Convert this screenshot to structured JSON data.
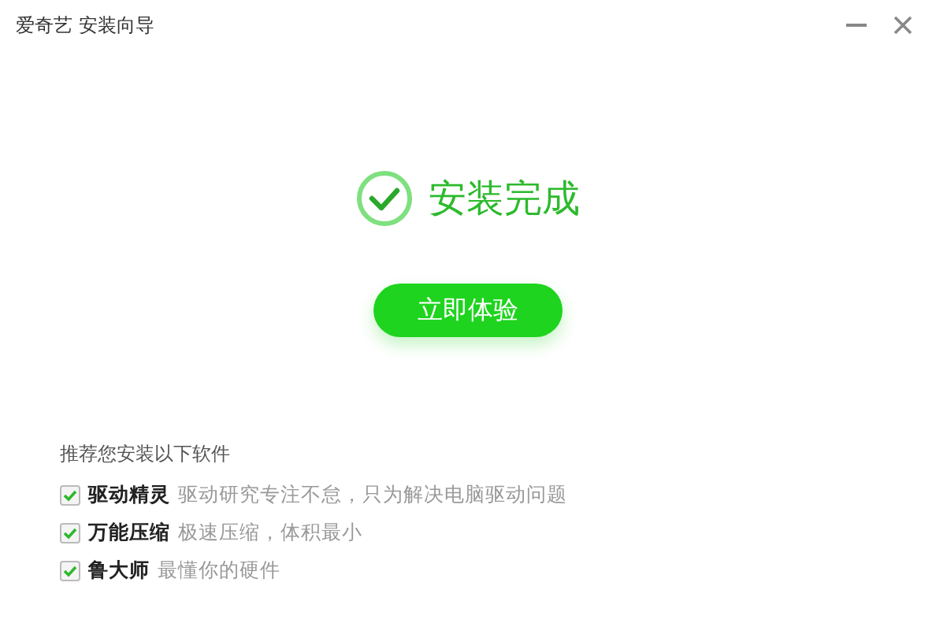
{
  "window": {
    "title": "爱奇艺 安装向导"
  },
  "status": {
    "message": "安装完成"
  },
  "primary_button": {
    "label": "立即体验"
  },
  "recommendations": {
    "heading": "推荐您安装以下软件",
    "items": [
      {
        "name": "驱动精灵",
        "description": "驱动研究专注不怠，只为解决电脑驱动问题",
        "checked": true
      },
      {
        "name": "万能压缩",
        "description": "极速压缩，体积最小",
        "checked": true
      },
      {
        "name": "鲁大师",
        "description": "最懂你的硬件",
        "checked": true
      }
    ]
  }
}
